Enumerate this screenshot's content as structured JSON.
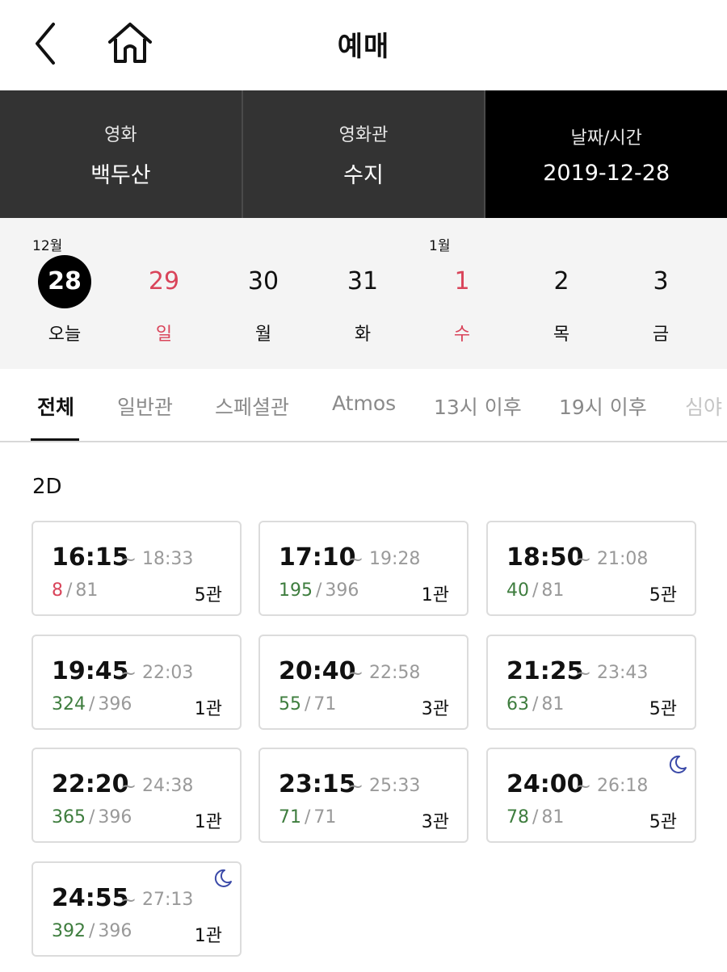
{
  "header": {
    "title": "예매"
  },
  "selection": {
    "movie": {
      "label": "영화",
      "value": "백두산"
    },
    "theater": {
      "label": "영화관",
      "value": "수지"
    },
    "datetime": {
      "label": "날짜/시간",
      "value": "2019-12-28"
    }
  },
  "dates": {
    "month_dec": "12월",
    "month_jan": "1월",
    "items": [
      {
        "num": "28",
        "day": "오늘",
        "selected": true,
        "red": false
      },
      {
        "num": "29",
        "day": "일",
        "selected": false,
        "red": true
      },
      {
        "num": "30",
        "day": "월",
        "selected": false,
        "red": false
      },
      {
        "num": "31",
        "day": "화",
        "selected": false,
        "red": false
      },
      {
        "num": "1",
        "day": "수",
        "selected": false,
        "red": true
      },
      {
        "num": "2",
        "day": "목",
        "selected": false,
        "red": false
      },
      {
        "num": "3",
        "day": "금",
        "selected": false,
        "red": false
      }
    ]
  },
  "tabs": [
    "전체",
    "일반관",
    "스페셜관",
    "Atmos",
    "13시 이후",
    "19시 이후",
    "심야"
  ],
  "section": {
    "title": "2D"
  },
  "showtimes": [
    {
      "start": "16:15",
      "end": "18:33",
      "available": "8",
      "total": "81",
      "hall": "5관",
      "low": true,
      "late_night": false
    },
    {
      "start": "17:10",
      "end": "19:28",
      "available": "195",
      "total": "396",
      "hall": "1관",
      "low": false,
      "late_night": false
    },
    {
      "start": "18:50",
      "end": "21:08",
      "available": "40",
      "total": "81",
      "hall": "5관",
      "low": false,
      "late_night": false
    },
    {
      "start": "19:45",
      "end": "22:03",
      "available": "324",
      "total": "396",
      "hall": "1관",
      "low": false,
      "late_night": false
    },
    {
      "start": "20:40",
      "end": "22:58",
      "available": "55",
      "total": "71",
      "hall": "3관",
      "low": false,
      "late_night": false
    },
    {
      "start": "21:25",
      "end": "23:43",
      "available": "63",
      "total": "81",
      "hall": "5관",
      "low": false,
      "late_night": false
    },
    {
      "start": "22:20",
      "end": "24:38",
      "available": "365",
      "total": "396",
      "hall": "1관",
      "low": false,
      "late_night": false
    },
    {
      "start": "23:15",
      "end": "25:33",
      "available": "71",
      "total": "71",
      "hall": "3관",
      "low": false,
      "late_night": false
    },
    {
      "start": "24:00",
      "end": "26:18",
      "available": "78",
      "total": "81",
      "hall": "5관",
      "low": false,
      "late_night": true
    },
    {
      "start": "24:55",
      "end": "27:13",
      "available": "392",
      "total": "396",
      "hall": "1관",
      "low": false,
      "late_night": true
    }
  ],
  "icons": {
    "back": "chevron-left-icon",
    "home": "home-icon",
    "late_night": "moon-icon"
  },
  "colors": {
    "accent_red": "#d9445a",
    "available_green": "#3e7d3e",
    "selection_bar": "#333333",
    "selection_active": "#000000"
  }
}
